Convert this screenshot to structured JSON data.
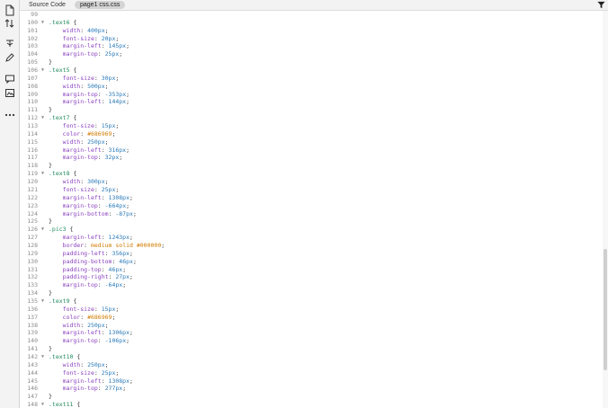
{
  "tabs": {
    "source_label": "Source Code",
    "file_label": "page1 css.css"
  },
  "toolbar_icons": [
    "new-document-icon",
    "sort-icon",
    "sparkle-icon",
    "pen-icon",
    "comment-icon",
    "image-comment-icon",
    "more-icon"
  ],
  "colors": {
    "selector": "#1f8a5d",
    "property": "#8a3fbf",
    "value": "#2979b8",
    "hex": "#d07b00"
  },
  "lines": [
    {
      "n": "99",
      "fold": "",
      "kind": "blank"
    },
    {
      "n": "100",
      "fold": "▼",
      "kind": "sel",
      "text": ".text6 {"
    },
    {
      "n": "101",
      "kind": "decl",
      "prop": "width",
      "val": "400px"
    },
    {
      "n": "102",
      "kind": "decl",
      "prop": "font-size",
      "val": "20px"
    },
    {
      "n": "103",
      "kind": "decl",
      "prop": "margin-left",
      "val": "145px"
    },
    {
      "n": "104",
      "kind": "decl",
      "prop": "margin-top",
      "val": "25px"
    },
    {
      "n": "105",
      "kind": "close"
    },
    {
      "n": "106",
      "fold": "▼",
      "kind": "sel",
      "text": ".text5 {"
    },
    {
      "n": "107",
      "kind": "decl",
      "prop": "font-size",
      "val": "30px"
    },
    {
      "n": "108",
      "kind": "decl",
      "prop": "width",
      "val": "500px"
    },
    {
      "n": "109",
      "kind": "decl",
      "prop": "margin-top",
      "val": "-353px"
    },
    {
      "n": "110",
      "kind": "decl",
      "prop": "margin-left",
      "val": "144px"
    },
    {
      "n": "111",
      "kind": "close"
    },
    {
      "n": "112",
      "fold": "▼",
      "kind": "sel",
      "text": ".text7 {"
    },
    {
      "n": "113",
      "kind": "decl",
      "prop": "font-size",
      "val": "15px"
    },
    {
      "n": "114",
      "kind": "decl",
      "prop": "color",
      "val": "#686969",
      "hex": true
    },
    {
      "n": "115",
      "kind": "decl",
      "prop": "width",
      "val": "250px"
    },
    {
      "n": "116",
      "kind": "decl",
      "prop": "margin-left",
      "val": "316px"
    },
    {
      "n": "117",
      "kind": "decl",
      "prop": "margin-top",
      "val": "32px"
    },
    {
      "n": "118",
      "kind": "close"
    },
    {
      "n": "119",
      "fold": "▼",
      "kind": "sel",
      "text": ".text8 {"
    },
    {
      "n": "120",
      "kind": "decl",
      "prop": "width",
      "val": "300px"
    },
    {
      "n": "121",
      "kind": "decl",
      "prop": "font-size",
      "val": "25px"
    },
    {
      "n": "122",
      "kind": "decl",
      "prop": "margin-left",
      "val": "1308px"
    },
    {
      "n": "123",
      "kind": "decl",
      "prop": "margin-top",
      "val": "-664px"
    },
    {
      "n": "124",
      "kind": "decl",
      "prop": "margin-bottom",
      "val": "-87px"
    },
    {
      "n": "125",
      "kind": "close"
    },
    {
      "n": "126",
      "fold": "▼",
      "kind": "sel",
      "text": ".pic3 {"
    },
    {
      "n": "127",
      "kind": "decl",
      "prop": "margin-left",
      "val": "1243px"
    },
    {
      "n": "128",
      "kind": "decl",
      "prop": "border",
      "val": "medium solid #000000",
      "hex": true
    },
    {
      "n": "129",
      "kind": "decl",
      "prop": "padding-left",
      "val": "356px"
    },
    {
      "n": "130",
      "kind": "decl",
      "prop": "padding-bottom",
      "val": "46px"
    },
    {
      "n": "131",
      "kind": "decl",
      "prop": "padding-top",
      "val": "46px"
    },
    {
      "n": "132",
      "kind": "decl",
      "prop": "padding-right",
      "val": "27px"
    },
    {
      "n": "133",
      "kind": "decl",
      "prop": "margin-top",
      "val": "-64px"
    },
    {
      "n": "134",
      "kind": "close"
    },
    {
      "n": "135",
      "fold": "▼",
      "kind": "sel",
      "text": ".text9 {"
    },
    {
      "n": "136",
      "kind": "decl",
      "prop": "font-size",
      "val": "15px"
    },
    {
      "n": "137",
      "kind": "decl",
      "prop": "color",
      "val": "#686969",
      "hex": true
    },
    {
      "n": "138",
      "kind": "decl",
      "prop": "width",
      "val": "250px"
    },
    {
      "n": "139",
      "kind": "decl",
      "prop": "margin-left",
      "val": "1306px"
    },
    {
      "n": "140",
      "kind": "decl",
      "prop": "margin-top",
      "val": "-106px"
    },
    {
      "n": "141",
      "kind": "close"
    },
    {
      "n": "142",
      "fold": "▼",
      "kind": "sel",
      "text": ".text10 {"
    },
    {
      "n": "143",
      "kind": "decl",
      "prop": "width",
      "val": "250px"
    },
    {
      "n": "144",
      "kind": "decl",
      "prop": "font-size",
      "val": "25px"
    },
    {
      "n": "145",
      "kind": "decl",
      "prop": "margin-left",
      "val": "1308px"
    },
    {
      "n": "146",
      "kind": "decl",
      "prop": "margin-top",
      "val": "277px"
    },
    {
      "n": "147",
      "kind": "close"
    },
    {
      "n": "148",
      "fold": "▼",
      "kind": "sel",
      "text": ".text11 {"
    }
  ]
}
